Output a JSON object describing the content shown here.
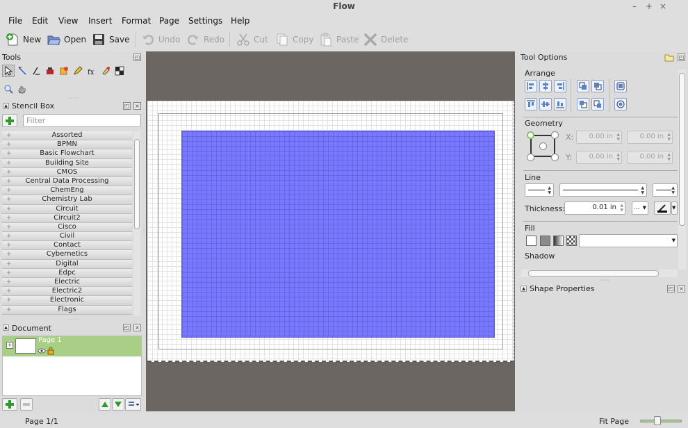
{
  "window": {
    "title": "Flow",
    "controls": [
      "–",
      "+",
      "×"
    ]
  },
  "menubar": {
    "items": [
      "File",
      "Edit",
      "View",
      "Insert",
      "Format",
      "Page",
      "Settings",
      "Help"
    ]
  },
  "toolbar": {
    "new": "New",
    "open": "Open",
    "save": "Save",
    "undo": "Undo",
    "redo": "Redo",
    "cut": "Cut",
    "copy": "Copy",
    "paste": "Paste",
    "delete": "Delete"
  },
  "tools_panel": {
    "title": "Tools"
  },
  "stencil_panel": {
    "title": "Stencil Box",
    "filter_placeholder": "Filter",
    "expander": "+",
    "items": [
      "Assorted",
      "BPMN",
      "Basic Flowchart",
      "Building Site",
      "CMOS",
      "Central Data Processing",
      "ChemEng",
      "Chemistry Lab",
      "Circuit",
      "Circuit2",
      "Cisco",
      "Civil",
      "Contact",
      "Cybernetics",
      "Digital",
      "Edpc",
      "Electric",
      "Electric2",
      "Electronic",
      "Flags"
    ]
  },
  "document_panel": {
    "title": "Document",
    "page_label": "Page 1",
    "expander": "+"
  },
  "tool_options": {
    "title": "Tool Options",
    "arrange_label": "Arrange",
    "geometry_label": "Geometry",
    "x_label": "X:",
    "y_label": "Y:",
    "x_value": "0.00 in",
    "x_value2": "0.00 in",
    "y_value": "0.00 in",
    "y_value2": "0.00 in",
    "line_label": "Line",
    "thickness_label": "Thickness:",
    "thickness_value": "0.01 in",
    "dash_menu": "...",
    "fill_label": "Fill",
    "shadow_label": "Shadow"
  },
  "shape_properties": {
    "title": "Shape Properties"
  },
  "canvas": {
    "shape_color": "#7878ff",
    "background_color": "#6b6661"
  },
  "statusbar": {
    "page": "Page 1/1",
    "zoom_mode": "Fit Page",
    "zoom_level": 0.45
  }
}
